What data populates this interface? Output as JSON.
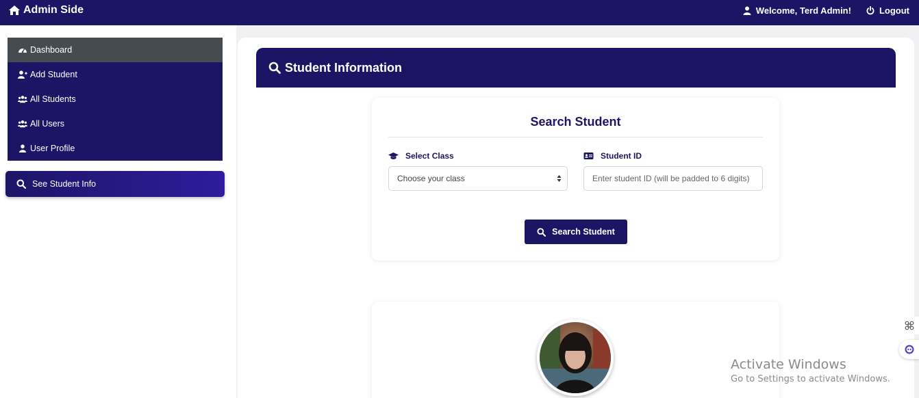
{
  "topbar": {
    "brand": "Admin Side",
    "welcome": "Welcome, Terd Admin!",
    "logout": "Logout"
  },
  "sidebar": {
    "items": [
      {
        "label": "Dashboard",
        "icon": "gauge-icon",
        "active": true
      },
      {
        "label": "Add Student",
        "icon": "user-plus-icon",
        "active": false
      },
      {
        "label": "All Students",
        "icon": "users-icon",
        "active": false
      },
      {
        "label": "All Users",
        "icon": "users-icon",
        "active": false
      },
      {
        "label": "User Profile",
        "icon": "user-icon",
        "active": false
      }
    ],
    "see_info": "See Student Info"
  },
  "main": {
    "header_title": "Student Information",
    "search": {
      "title": "Search Student",
      "class_label": "Select Class",
      "class_value": "Choose your class",
      "id_label": "Student ID",
      "id_placeholder": "Enter student ID (will be padded to 6 digits)",
      "button": "Search Student"
    }
  },
  "overlay": {
    "activate_title": "Activate Windows",
    "activate_sub": "Go to Settings to activate Windows."
  },
  "colors": {
    "primary": "#1c1464",
    "active_nav": "#464b50",
    "gradient_end": "#2e1c9c"
  }
}
